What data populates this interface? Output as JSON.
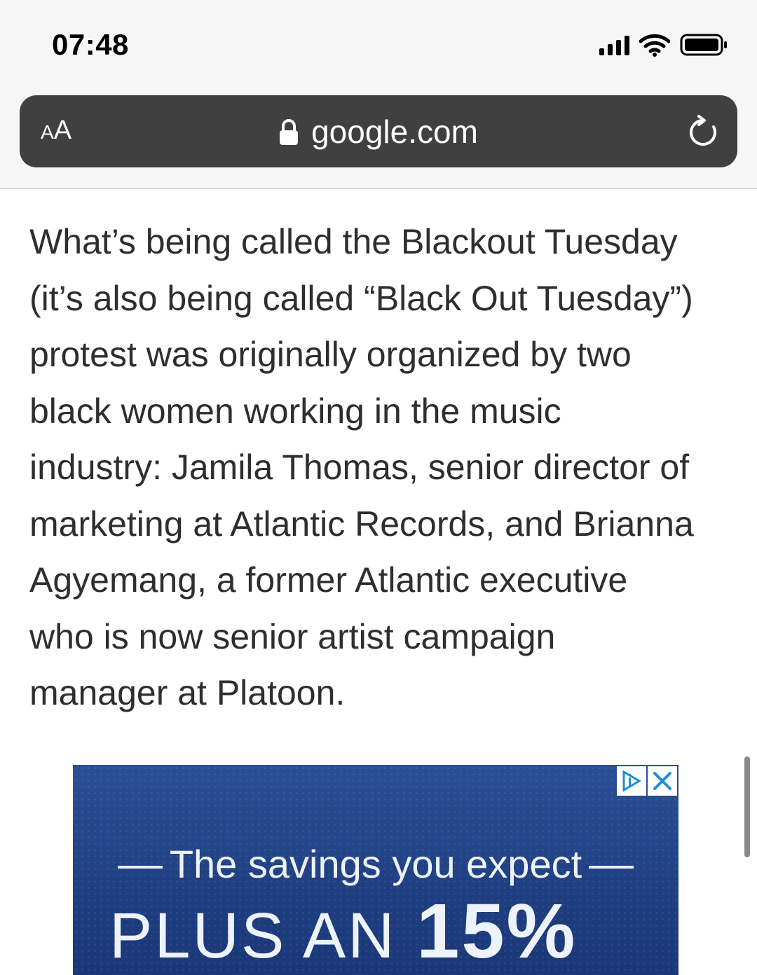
{
  "status_bar": {
    "time": "07:48",
    "signal_icon": "cellular-signal-icon",
    "wifi_icon": "wifi-icon",
    "battery_icon": "battery-icon"
  },
  "browser": {
    "text_size_label_small": "A",
    "text_size_label_large": "A",
    "url": "google.com",
    "lock_icon": "lock-icon",
    "reload_icon": "reload-icon"
  },
  "article": {
    "lines": [
      "What’s being called the Blackout Tuesday",
      "(it’s also being called “Black Out Tuesday”)",
      "protest was originally organized by two",
      "black women working in the music",
      "industry: Jamila Thomas, senior director of",
      "marketing at Atlantic Records, and Brianna",
      "Agyemang, a former Atlantic executive",
      "who is now senior artist campaign",
      "manager at Platoon."
    ]
  },
  "ad": {
    "tagline": "The savings you expect",
    "headline_text": "PLUS AN",
    "headline_number": "15%",
    "adchoices_icon": "adchoices-icon",
    "close_icon": "close-icon",
    "background_color": "#23468a"
  }
}
